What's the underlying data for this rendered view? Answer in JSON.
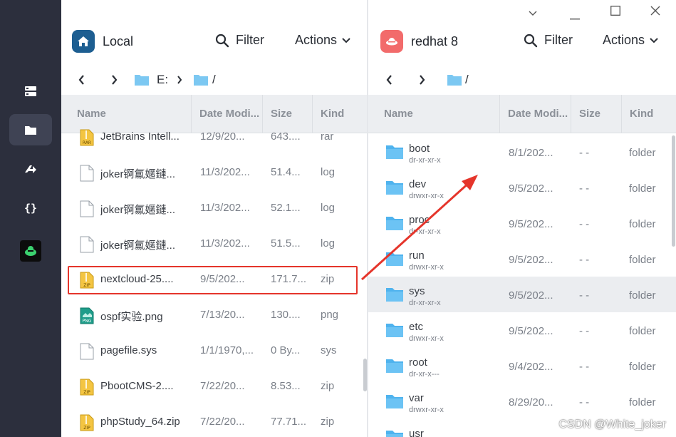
{
  "sidebar": {
    "items": [
      {
        "name": "hosts-icon",
        "active": false
      },
      {
        "name": "sftp-folder-icon",
        "active": true
      },
      {
        "name": "port-forward-icon",
        "active": false
      },
      {
        "name": "snippets-icon",
        "active": false
      },
      {
        "name": "app-logo-icon",
        "active": false
      }
    ]
  },
  "left": {
    "title": "Local",
    "filter_label": "Filter",
    "actions_label": "Actions",
    "path": [
      "E:",
      "/"
    ],
    "columns": [
      "Name",
      "Date Modi...",
      "Size",
      "Kind"
    ],
    "rows": [
      {
        "name": "JetBrains Intell...",
        "date": "12/9/20...",
        "size": "643....",
        "kind": "rar",
        "icon": "rar"
      },
      {
        "name": "joker锕氱嫟鏈...",
        "date": "11/3/202...",
        "size": "51.4...",
        "kind": "log",
        "icon": "doc"
      },
      {
        "name": "joker锕氱嫟鏈...",
        "date": "11/3/202...",
        "size": "52.1...",
        "kind": "log",
        "icon": "doc"
      },
      {
        "name": "joker锕氱嫟鏈...",
        "date": "11/3/202...",
        "size": "51.5...",
        "kind": "log",
        "icon": "doc"
      },
      {
        "name": "nextcloud-25....",
        "date": "9/5/202...",
        "size": "171.7...",
        "kind": "zip",
        "icon": "zip"
      },
      {
        "name": "ospf实验.png",
        "date": "7/13/20...",
        "size": "130....",
        "kind": "png",
        "icon": "png"
      },
      {
        "name": "pagefile.sys",
        "date": "1/1/1970,...",
        "size": "0 By...",
        "kind": "sys",
        "icon": "doc"
      },
      {
        "name": "PbootCMS-2....",
        "date": "7/22/20...",
        "size": "8.53...",
        "kind": "zip",
        "icon": "zip"
      },
      {
        "name": "phpStudy_64.zip",
        "date": "7/22/20...",
        "size": "77.71...",
        "kind": "zip",
        "icon": "zip"
      }
    ]
  },
  "right": {
    "title": "redhat 8",
    "filter_label": "Filter",
    "actions_label": "Actions",
    "path": [
      "/"
    ],
    "columns": [
      "Name",
      "Date Modi...",
      "Size",
      "Kind"
    ],
    "rows": [
      {
        "name": "boot",
        "perm": "dr-xr-xr-x",
        "date": "8/1/202...",
        "size": "- -",
        "kind": "folder"
      },
      {
        "name": "dev",
        "perm": "drwxr-xr-x",
        "date": "9/5/202...",
        "size": "- -",
        "kind": "folder"
      },
      {
        "name": "proc",
        "perm": "dr-xr-xr-x",
        "date": "9/5/202...",
        "size": "- -",
        "kind": "folder"
      },
      {
        "name": "run",
        "perm": "drwxr-xr-x",
        "date": "9/5/202...",
        "size": "- -",
        "kind": "folder"
      },
      {
        "name": "sys",
        "perm": "dr-xr-xr-x",
        "date": "9/5/202...",
        "size": "- -",
        "kind": "folder"
      },
      {
        "name": "etc",
        "perm": "drwxr-xr-x",
        "date": "9/5/202...",
        "size": "- -",
        "kind": "folder"
      },
      {
        "name": "root",
        "perm": "dr-xr-x---",
        "date": "9/4/202...",
        "size": "- -",
        "kind": "folder"
      },
      {
        "name": "var",
        "perm": "drwxr-xr-x",
        "date": "8/29/20...",
        "size": "- -",
        "kind": "folder"
      },
      {
        "name": "usr",
        "perm": "",
        "date": "",
        "size": "",
        "kind": ""
      }
    ]
  },
  "watermark": "CSDN @White_joker",
  "colors": {
    "sidebar": "#2c2f3d",
    "accent_folder": "#4fb3ee",
    "local_icon": "#1d5e91",
    "redhat_icon": "#f26b6b",
    "annotation_red": "#e5352b"
  }
}
